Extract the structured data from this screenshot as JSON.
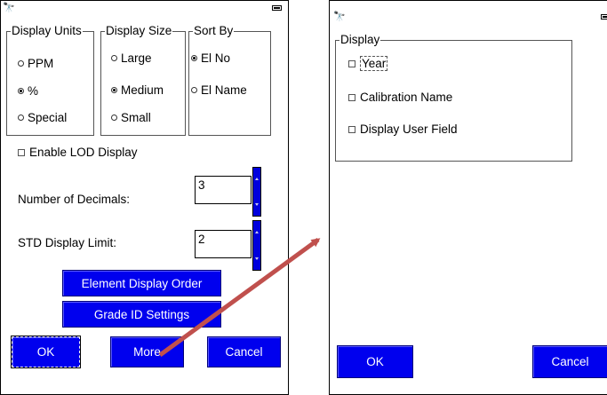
{
  "left": {
    "icons": {
      "device": "binoculars-icon",
      "battery": "battery-icon"
    },
    "display_units": {
      "legend": "Display Units",
      "options": [
        {
          "label": "PPM",
          "selected": false
        },
        {
          "label": "%",
          "selected": true
        },
        {
          "label": "Special",
          "selected": false
        }
      ]
    },
    "display_size": {
      "legend": "Display Size",
      "options": [
        {
          "label": "Large",
          "selected": false
        },
        {
          "label": "Medium",
          "selected": true
        },
        {
          "label": "Small",
          "selected": false
        }
      ]
    },
    "sort_by": {
      "legend": "Sort By",
      "options": [
        {
          "label": "El No",
          "selected": true
        },
        {
          "label": "El Name",
          "selected": false
        }
      ]
    },
    "enable_lod": {
      "label": "Enable LOD Display",
      "checked": false
    },
    "decimals": {
      "label": "Number of Decimals:",
      "value": "3"
    },
    "std_limit": {
      "label": "STD Display Limit:",
      "value": "2"
    },
    "buttons": {
      "element_order": "Element Display Order",
      "grade_id": "Grade ID Settings",
      "ok": "OK",
      "more": "More",
      "cancel": "Cancel"
    }
  },
  "right": {
    "icons": {
      "device": "binoculars-icon",
      "battery": "battery-icon"
    },
    "display": {
      "legend": "Display",
      "options": [
        {
          "label": "Year",
          "checked": false
        },
        {
          "label": "Calibration Name",
          "checked": false
        },
        {
          "label": "Display User Field",
          "checked": false
        }
      ]
    },
    "buttons": {
      "ok": "OK",
      "cancel": "Cancel"
    }
  },
  "colors": {
    "button": "#0000ee",
    "arrow": "#c0504d"
  }
}
